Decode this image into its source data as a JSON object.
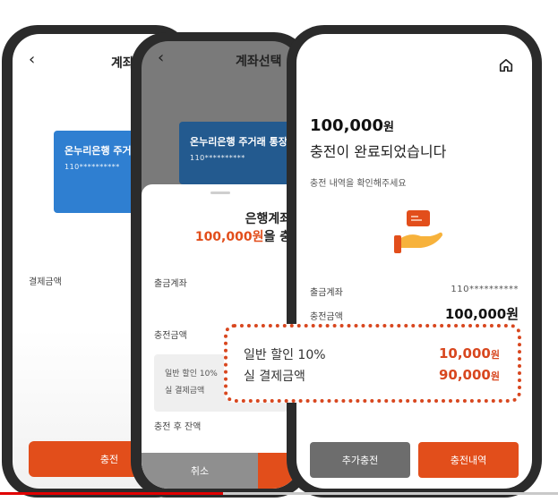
{
  "phone1": {
    "header_title": "계좌",
    "card": {
      "bank_name": "온누리은행 주거래",
      "account_number": "110**********"
    },
    "payment_label": "결제금액",
    "charge_button": "충전"
  },
  "phone2": {
    "header_title": "계좌선택",
    "card": {
      "bank_name": "온누리은행 주거래 통장",
      "account_number": "110**********"
    },
    "sheet_title": "은행계좌로",
    "sheet_amount": "100,000원",
    "sheet_amount_suffix": "을 충전",
    "withdraw_label": "출금계좌",
    "charge_amount_label": "충전금액",
    "discount_line": "일반 할인 10%",
    "actual_line": "실 결제금액",
    "balance_label": "충전 후 잔액",
    "cancel_button": "취소"
  },
  "phone3": {
    "amount": "100,000",
    "amount_unit": "원",
    "done_message": "충전이 완료되었습니다",
    "sub_message": "충전 내역을 확인해주세요",
    "withdraw_label": "출금계좌",
    "withdraw_value": "110**********",
    "charge_label": "충전금액",
    "charge_value": "100,000원",
    "more_button": "추가충전",
    "history_button": "충전내역"
  },
  "callout": {
    "discount_label": "일반 할인 10%",
    "discount_value": "10,000",
    "actual_label": "실 결제금액",
    "actual_value": "90,000",
    "unit": "원"
  },
  "video": {
    "progress": 0.4
  },
  "colors": {
    "accent": "#e24e1b",
    "card_blue": "#2f7fd1",
    "progress_red": "#e00000"
  }
}
